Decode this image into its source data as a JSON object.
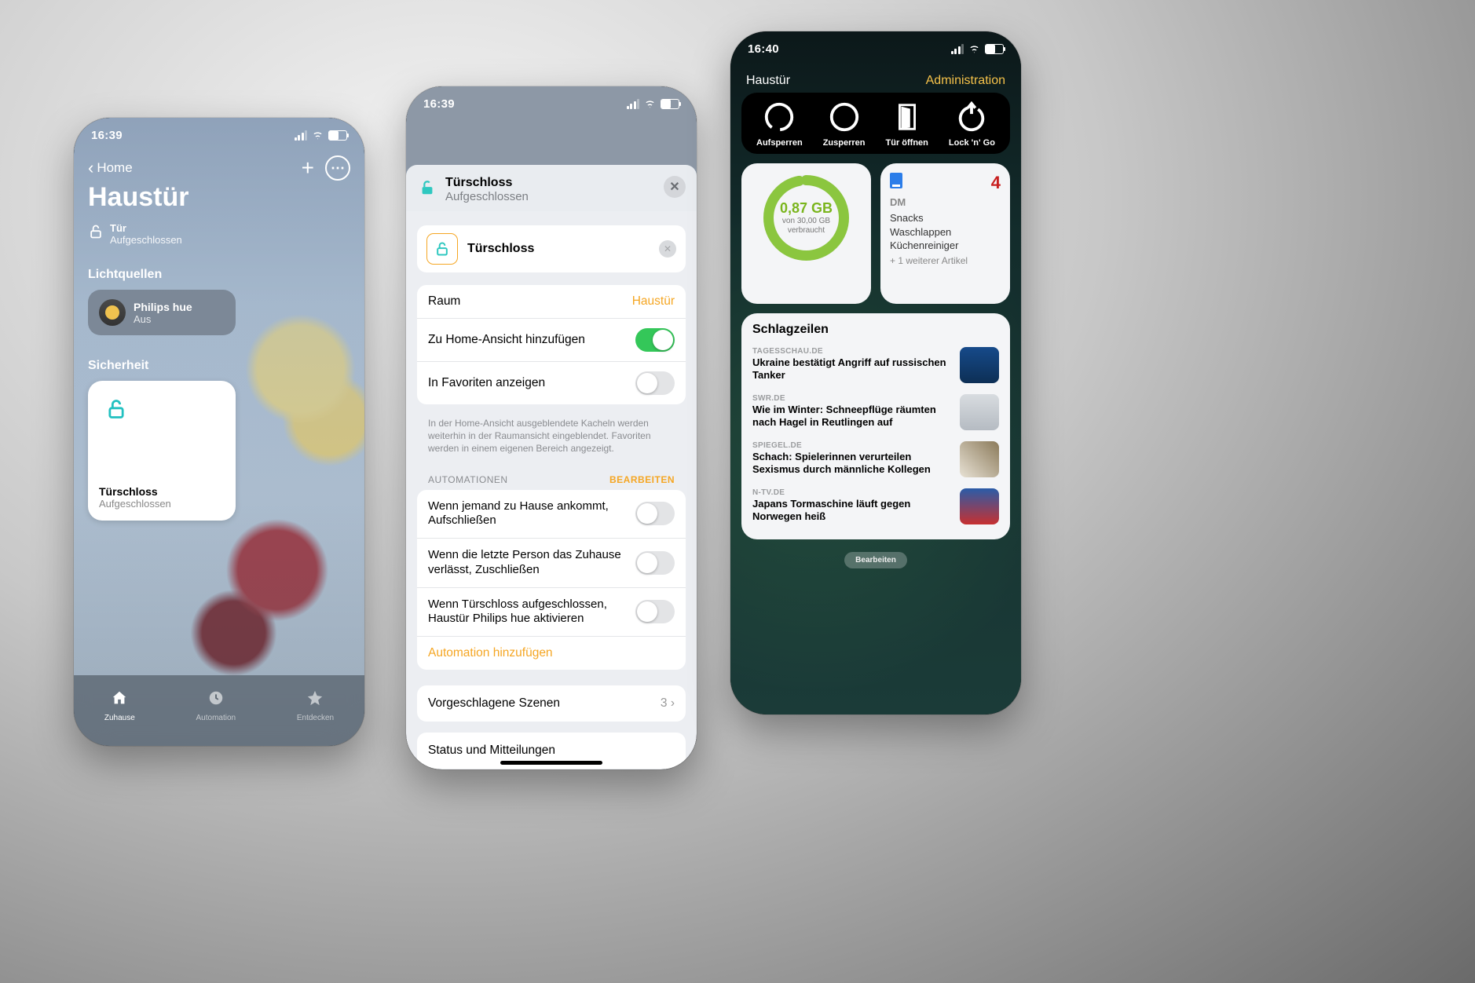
{
  "phone1": {
    "time": "16:39",
    "back": "Home",
    "title": "Haustür",
    "door": {
      "label": "Tür",
      "status": "Aufgeschlossen"
    },
    "section_lights": "Lichtquellen",
    "light_tile": {
      "name": "Philips hue",
      "state": "Aus"
    },
    "section_security": "Sicherheit",
    "lock_tile": {
      "name": "Türschloss",
      "state": "Aufgeschlossen"
    },
    "tabs": {
      "home": "Zuhause",
      "auto": "Automation",
      "discover": "Entdecken"
    }
  },
  "phone2": {
    "time": "16:39",
    "header": {
      "name": "Türschloss",
      "state": "Aufgeschlossen"
    },
    "name_field": "Türschloss",
    "room": {
      "label": "Raum",
      "value": "Haustür"
    },
    "add_home": "Zu Home-Ansicht hinzufügen",
    "fav": "In Favoriten anzeigen",
    "footnote": "In der Home-Ansicht ausgeblendete Kacheln werden weiterhin in der Raumansicht eingeblendet. Favoriten werden in einem eigenen Bereich angezeigt.",
    "auto_header": "AUTOMATIONEN",
    "auto_edit": "BEARBEITEN",
    "automations": [
      "Wenn jemand zu Hause ankommt, Aufschließen",
      "Wenn die letzte Person das Zuhause verlässt, Zuschließen",
      "Wenn Türschloss aufgeschlossen, Haustür Philips hue aktivieren"
    ],
    "add_auto": "Automation hinzufügen",
    "scenes": {
      "label": "Vorgeschlagene Szenen",
      "count": "3"
    },
    "status_row": "Status und Mitteilungen"
  },
  "phone3": {
    "time": "16:40",
    "widget_title": "Haustür",
    "widget_link": "Administration",
    "nuki": [
      "Aufsperren",
      "Zusperren",
      "Tür öffnen",
      "Lock 'n' Go"
    ],
    "data": {
      "used": "0,87 GB",
      "of": "von 30,00 GB",
      "verb": "verbraucht"
    },
    "dm": {
      "title": "DM",
      "badge": "4",
      "items": [
        "Snacks",
        "Waschlappen",
        "Küchenreiniger"
      ],
      "more": "+ 1 weiterer Artikel"
    },
    "news": {
      "title": "Schlagzeilen",
      "items": [
        {
          "src": "TAGESSCHAU.DE",
          "hl": "Ukraine bestätigt Angriff auf russischen Tanker",
          "color": "linear-gradient(#164a8a,#0d2f55)"
        },
        {
          "src": "SWR.DE",
          "hl": "Wie im Winter: Schneepflüge räumten nach Hagel in Reutlingen auf",
          "color": "linear-gradient(#d8dce0,#b5bbc2)"
        },
        {
          "src": "SPIEGEL.DE",
          "hl": "Schach: Spielerinnen verurteilen Sexismus durch männliche Kollegen",
          "color": "linear-gradient(45deg,#e8e2d5,#8b7a5a)"
        },
        {
          "src": "N-TV.DE",
          "hl": "Japans Tormaschine läuft gegen Norwegen heiß",
          "color": "linear-gradient(#2a5ca8,#c73030)"
        }
      ]
    },
    "edit": "Bearbeiten"
  }
}
